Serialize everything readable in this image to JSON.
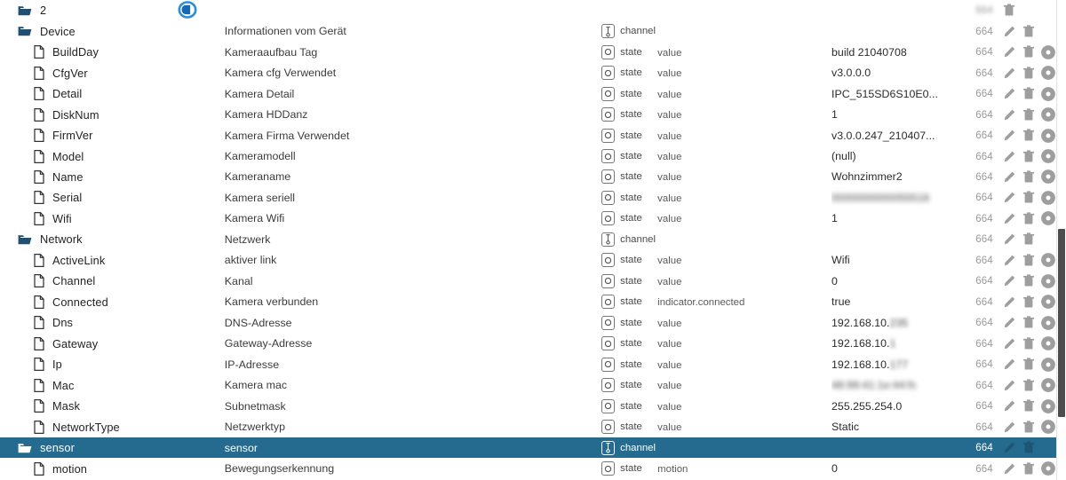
{
  "app": {
    "root_label": "2",
    "logo_icon": "iobroker-bubble-icon",
    "selected_row_color": "#246b8f",
    "scrollbar": {
      "position": "right",
      "thumb_visible": true
    }
  },
  "columns": {
    "name": "",
    "description": "",
    "type": "",
    "role": "",
    "value": "",
    "permission": "",
    "actions": ""
  },
  "rows": [
    {
      "name": "2",
      "indent": 0,
      "icon": "folder-icon",
      "desc": "",
      "type": "",
      "role": "",
      "value": "",
      "perm": "664",
      "perm_blurred": true,
      "actions": [
        "delete-icon"
      ],
      "selected": false
    },
    {
      "name": "Device",
      "indent": 1,
      "icon": "folder-icon",
      "desc": "Informationen vom Gerät",
      "type": "channel",
      "type_icon": "channel-icon",
      "role": "",
      "value": "",
      "perm": "664",
      "actions": [
        "edit-icon",
        "delete-icon"
      ],
      "selected": false
    },
    {
      "name": "BuildDay",
      "indent": 2,
      "icon": "file-icon",
      "desc": "Kameraaufbau Tag",
      "type": "state",
      "type_icon": "state-icon",
      "role": "value",
      "value": "build 21040708",
      "perm": "664",
      "actions": [
        "edit-icon",
        "delete-icon",
        "settings-icon"
      ],
      "selected": false
    },
    {
      "name": "CfgVer",
      "indent": 2,
      "icon": "file-icon",
      "desc": "Kamera cfg Verwendet",
      "type": "state",
      "type_icon": "state-icon",
      "role": "value",
      "value": "v3.0.0.0",
      "perm": "664",
      "actions": [
        "edit-icon",
        "delete-icon",
        "settings-icon"
      ],
      "selected": false
    },
    {
      "name": "Detail",
      "indent": 2,
      "icon": "file-icon",
      "desc": "Kamera Detail",
      "type": "state",
      "type_icon": "state-icon",
      "role": "value",
      "value": "IPC_515SD6S10E0...",
      "perm": "664",
      "actions": [
        "edit-icon",
        "delete-icon",
        "settings-icon"
      ],
      "selected": false
    },
    {
      "name": "DiskNum",
      "indent": 2,
      "icon": "file-icon",
      "desc": "Kamera HDDanz",
      "type": "state",
      "type_icon": "state-icon",
      "role": "value",
      "value": "1",
      "perm": "664",
      "actions": [
        "edit-icon",
        "delete-icon",
        "settings-icon"
      ],
      "selected": false
    },
    {
      "name": "FirmVer",
      "indent": 2,
      "icon": "file-icon",
      "desc": "Kamera Firma Verwendet",
      "type": "state",
      "type_icon": "state-icon",
      "role": "value",
      "value": "v3.0.0.247_210407...",
      "perm": "664",
      "actions": [
        "edit-icon",
        "delete-icon",
        "settings-icon"
      ],
      "selected": false
    },
    {
      "name": "Model",
      "indent": 2,
      "icon": "file-icon",
      "desc": "Kameramodell",
      "type": "state",
      "type_icon": "state-icon",
      "role": "value",
      "value": "(null)",
      "perm": "664",
      "actions": [
        "edit-icon",
        "delete-icon",
        "settings-icon"
      ],
      "selected": false
    },
    {
      "name": "Name",
      "indent": 2,
      "icon": "file-icon",
      "desc": "Kameraname",
      "type": "state",
      "type_icon": "state-icon",
      "role": "value",
      "value": "Wohnzimmer2",
      "perm": "664",
      "actions": [
        "edit-icon",
        "delete-icon",
        "settings-icon"
      ],
      "selected": false
    },
    {
      "name": "Serial",
      "indent": 2,
      "icon": "file-icon",
      "desc": "Kamera seriell",
      "type": "state",
      "type_icon": "state-icon",
      "role": "value",
      "value": "0000000000055516",
      "value_blurred": true,
      "perm": "664",
      "actions": [
        "edit-icon",
        "delete-icon",
        "settings-icon"
      ],
      "selected": false
    },
    {
      "name": "Wifi",
      "indent": 2,
      "icon": "file-icon",
      "desc": "Kamera Wifi",
      "type": "state",
      "type_icon": "state-icon",
      "role": "value",
      "value": "1",
      "perm": "664",
      "actions": [
        "edit-icon",
        "delete-icon",
        "settings-icon"
      ],
      "selected": false
    },
    {
      "name": "Network",
      "indent": 1,
      "icon": "folder-icon",
      "desc": "Netzwerk",
      "type": "channel",
      "type_icon": "channel-icon",
      "role": "",
      "value": "",
      "perm": "664",
      "actions": [
        "edit-icon",
        "delete-icon"
      ],
      "selected": false
    },
    {
      "name": "ActiveLink",
      "indent": 2,
      "icon": "file-icon",
      "desc": "aktiver link",
      "type": "state",
      "type_icon": "state-icon",
      "role": "value",
      "value": "Wifi",
      "perm": "664",
      "actions": [
        "edit-icon",
        "delete-icon",
        "settings-icon"
      ],
      "selected": false
    },
    {
      "name": "Channel",
      "indent": 2,
      "icon": "file-icon",
      "desc": "Kanal",
      "type": "state",
      "type_icon": "state-icon",
      "role": "value",
      "value": "0",
      "perm": "664",
      "actions": [
        "edit-icon",
        "delete-icon",
        "settings-icon"
      ],
      "selected": false
    },
    {
      "name": "Connected",
      "indent": 2,
      "icon": "file-icon",
      "desc": "Kamera verbunden",
      "type": "state",
      "type_icon": "state-icon",
      "role": "indicator.connected",
      "value": "true",
      "perm": "664",
      "actions": [
        "edit-icon",
        "delete-icon",
        "settings-icon"
      ],
      "selected": false
    },
    {
      "name": "Dns",
      "indent": 2,
      "icon": "file-icon",
      "desc": "DNS-Adresse",
      "type": "state",
      "type_icon": "state-icon",
      "role": "value",
      "value": "192.168.10.",
      "value_suffix": "235",
      "value_suffix_blurred": true,
      "perm": "664",
      "actions": [
        "edit-icon",
        "delete-icon",
        "settings-icon"
      ],
      "selected": false
    },
    {
      "name": "Gateway",
      "indent": 2,
      "icon": "file-icon",
      "desc": "Gateway-Adresse",
      "type": "state",
      "type_icon": "state-icon",
      "role": "value",
      "value": "192.168.10.",
      "value_suffix": "1",
      "value_suffix_blurred": true,
      "perm": "664",
      "actions": [
        "edit-icon",
        "delete-icon",
        "settings-icon"
      ],
      "selected": false
    },
    {
      "name": "Ip",
      "indent": 2,
      "icon": "file-icon",
      "desc": "IP-Adresse",
      "type": "state",
      "type_icon": "state-icon",
      "role": "value",
      "value": "192.168.10.",
      "value_suffix": "177",
      "value_suffix_blurred": true,
      "perm": "664",
      "actions": [
        "edit-icon",
        "delete-icon",
        "settings-icon"
      ],
      "selected": false
    },
    {
      "name": "Mac",
      "indent": 2,
      "icon": "file-icon",
      "desc": "Kamera mac",
      "type": "state",
      "type_icon": "state-icon",
      "role": "value",
      "value": "48:99:41:1e:44:fc",
      "value_blurred": true,
      "perm": "664",
      "actions": [
        "edit-icon",
        "delete-icon",
        "settings-icon"
      ],
      "selected": false
    },
    {
      "name": "Mask",
      "indent": 2,
      "icon": "file-icon",
      "desc": "Subnetmask",
      "type": "state",
      "type_icon": "state-icon",
      "role": "value",
      "value": "255.255.254.0",
      "perm": "664",
      "actions": [
        "edit-icon",
        "delete-icon",
        "settings-icon"
      ],
      "selected": false
    },
    {
      "name": "NetworkType",
      "indent": 2,
      "icon": "file-icon",
      "desc": "Netzwerktyp",
      "type": "state",
      "type_icon": "state-icon",
      "role": "value",
      "value": "Static",
      "perm": "664",
      "actions": [
        "edit-icon",
        "delete-icon",
        "settings-icon"
      ],
      "selected": false
    },
    {
      "name": "sensor",
      "indent": 1,
      "icon": "folder-icon",
      "desc": "sensor",
      "type": "channel",
      "type_icon": "channel-icon",
      "role": "",
      "value": "",
      "perm": "664",
      "actions": [
        "edit-icon",
        "delete-icon"
      ],
      "selected": true
    },
    {
      "name": "motion",
      "indent": 2,
      "icon": "file-icon",
      "desc": "Bewegungserkennung",
      "type": "state",
      "type_icon": "state-icon",
      "role": "motion",
      "value": "0",
      "perm": "664",
      "actions": [
        "edit-icon",
        "delete-icon",
        "settings-icon"
      ],
      "selected": false
    }
  ]
}
